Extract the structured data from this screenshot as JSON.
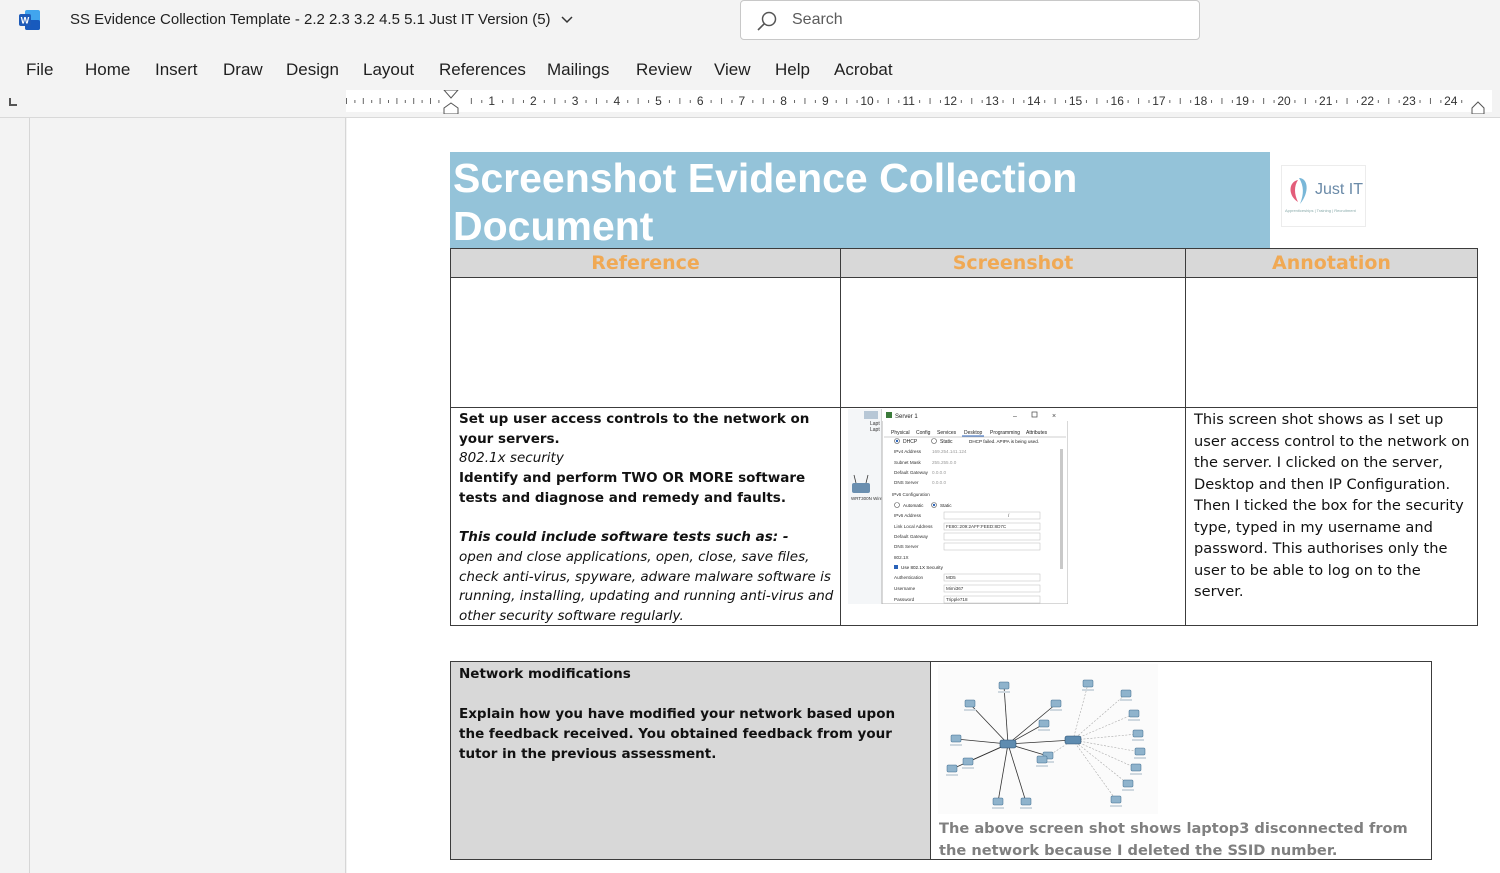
{
  "window": {
    "title": "SS Evidence Collection Template - 2.2 2.3 3.2 4.5 5.1 Just IT Version (5)",
    "app_icon": "word-icon",
    "search_placeholder": "Search"
  },
  "ribbon": {
    "tabs": [
      "File",
      "Home",
      "Insert",
      "Draw",
      "Design",
      "Layout",
      "References",
      "Mailings",
      "Review",
      "View",
      "Help",
      "Acrobat"
    ]
  },
  "ruler": {
    "numbers": [
      "1",
      "2",
      "3",
      "4",
      "5",
      "6",
      "7",
      "8",
      "9",
      "10",
      "11",
      "12",
      "13",
      "14",
      "15",
      "16",
      "17",
      "18",
      "19",
      "20",
      "21",
      "22",
      "23",
      "24"
    ]
  },
  "document": {
    "header_title": "Screenshot Evidence Collection Document",
    "logo": {
      "brand": "Just IT",
      "tagline": "Apprenticeships | Training | Recruitment"
    },
    "table1": {
      "headers": [
        "Reference",
        "Screenshot",
        "Annotation"
      ],
      "row2": {
        "ref_line1": "Set up user access controls to the network on your servers.",
        "ref_line2": "802.1x security",
        "ref_line3": "Identify and perform TWO OR MORE software tests and diagnose and remedy and faults.",
        "ref_line4": "This could include software tests such as: -",
        "ref_line5": "open and close applications, open, close, save files, check anti-virus, spyware, adware malware software is running, installing, updating and running anti-virus and other security software regularly.",
        "annotation": "This screen shot shows as I set up user access control to the network on the server.  I clicked on the server, Desktop and then IP Configuration. Then I ticked the box for the security type, typed in my username and password. This authorises only the user to be able to log on to the server."
      }
    },
    "table2": {
      "title": "Network modifications",
      "body": "Explain how you have modified your network based upon the feedback received. You obtained feedback from your tutor in the previous assessment.",
      "caption": "The above screen shot shows laptop3 disconnected from the network because I deleted the SSID number."
    },
    "screenshot1": {
      "window_title": "Server 1",
      "tabs": [
        "Physical",
        "Config",
        "Services",
        "Desktop",
        "Programming",
        "Attributes"
      ],
      "rows": [
        {
          "label": "IPv4 Address",
          "value": "169.254.141.124"
        },
        {
          "label": "Subnet Mask",
          "value": "255.255.0.0"
        },
        {
          "label": "Default Gateway",
          "value": "0.0.0.0"
        },
        {
          "label": "DNS Server",
          "value": "0.0.0.0"
        }
      ],
      "ipv6_label": "IPv6 Configuration",
      "dhcp_msg": "DHCP failed. APIPA is being used.",
      "link_local": "FE80::209:2AFF:FEED:8D7C",
      "auth_value": "MD5",
      "username": "Mimi367",
      "password": "Tripple718",
      "router_label": "WRT300N Wireless Router0"
    }
  }
}
